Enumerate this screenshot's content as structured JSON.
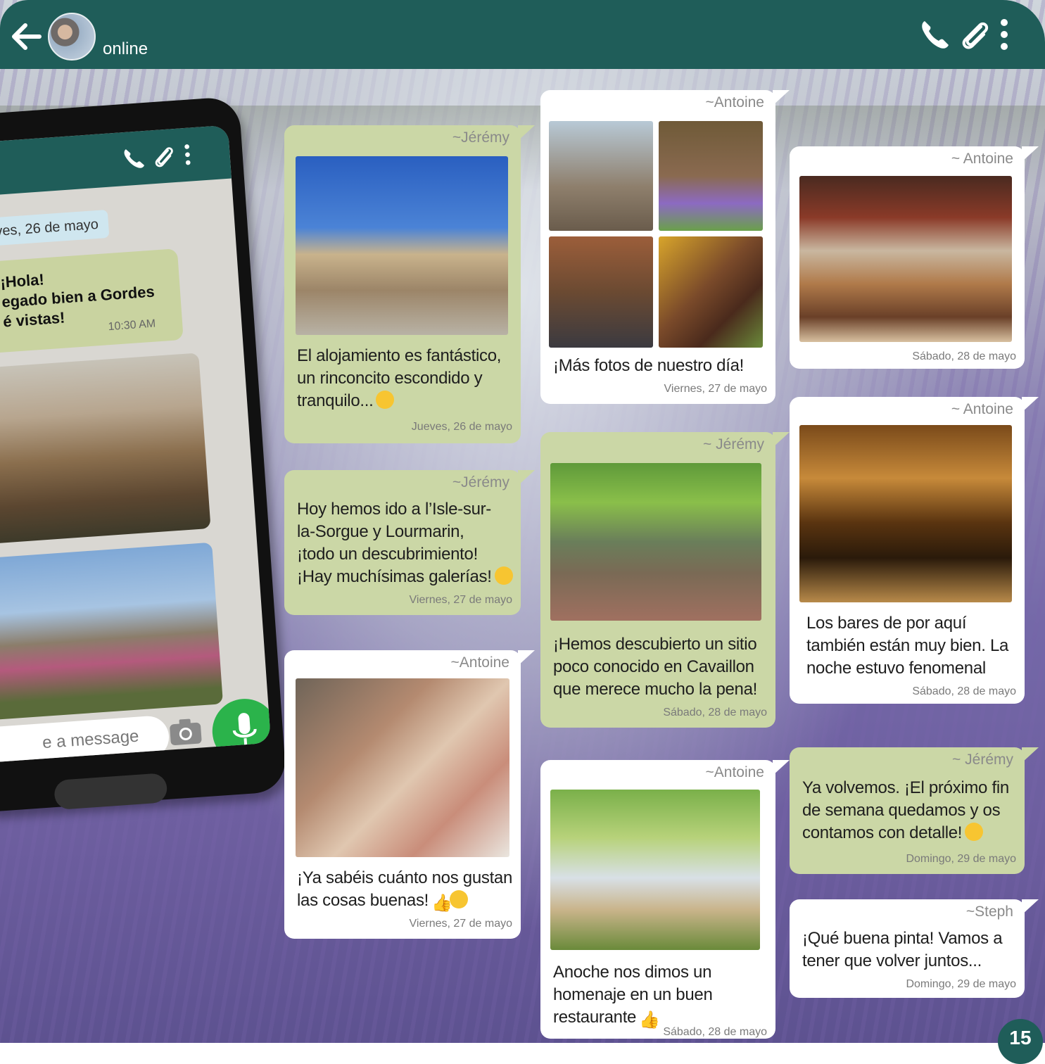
{
  "header": {
    "status": "online",
    "icons": [
      "back-arrow-icon",
      "avatar",
      "phone-icon",
      "paperclip-icon",
      "more-vertical-icon"
    ],
    "color": "#1f5d59"
  },
  "phone": {
    "date_chip": "ves, 26 de mayo",
    "message_lines": [
      "¡Hola!",
      "egado bien a Gordes",
      "é vistas!"
    ],
    "time": "10:30 AM",
    "input_placeholder": "e a message",
    "icons": [
      "phone-icon",
      "paperclip-icon",
      "more-vertical-icon",
      "camera-icon",
      "microphone-icon"
    ]
  },
  "messages": [
    {
      "sender": "~Jérémy",
      "text_lines": [
        "El alojamiento es fantástico,",
        "un rinconcito escondido y",
        "tranquilo..."
      ],
      "emoji": "sleeping-face",
      "date": "Jueves, 26 de mayo",
      "style": "green"
    },
    {
      "sender": "~Jérémy",
      "text_lines": [
        "Hoy hemos ido a l’Isle-sur-",
        "la-Sorgue y Lourmarin,",
        "¡todo un descubrimiento!",
        "¡Hay muchísimas galerías!"
      ],
      "emoji": "heart-eyes",
      "date": "Viernes, 27 de mayo",
      "style": "green"
    },
    {
      "sender": "~Antoine",
      "text_lines": [
        "¡Ya sabéis cuánto nos gustan",
        "las cosas buenas!"
      ],
      "emoji": "thumbs-up sunglasses",
      "date": "Viernes, 27 de mayo",
      "style": "white"
    },
    {
      "sender": "~Antoine",
      "text_lines": [
        "¡Más fotos de nuestro día!"
      ],
      "date": "Viernes, 27 de mayo",
      "style": "white"
    },
    {
      "sender": "~ Jérémy",
      "text_lines": [
        "¡Hemos descubierto un sitio",
        "poco conocido en Cavaillon",
        "que merece mucho la pena!"
      ],
      "date": "Sábado, 28 de mayo",
      "style": "green"
    },
    {
      "sender": "~Antoine",
      "text_lines": [
        "Anoche nos dimos un",
        "homenaje en un buen",
        "restaurante"
      ],
      "emoji": "thumbs-up",
      "date": "Sábado, 28 de mayo",
      "style": "white"
    },
    {
      "sender": "~ Antoine",
      "text_lines": [],
      "date": "Sábado, 28 de mayo",
      "style": "white"
    },
    {
      "sender": "~ Antoine",
      "text_lines": [
        "Los bares de por aquí",
        "también están muy bien. La",
        "noche estuvo fenomenal"
      ],
      "date": "Sábado, 28 de mayo",
      "style": "white"
    },
    {
      "sender": "~ Jérémy",
      "text_lines": [
        "Ya volvemos. ¡El próximo fin",
        "de semana quedamos y os",
        "contamos con detalle!"
      ],
      "emoji": "heart-eyes",
      "date": "Domingo, 29 de mayo",
      "style": "green"
    },
    {
      "sender": "~Steph",
      "text_lines": [
        "¡Qué buena pinta! Vamos a",
        "tener que volver juntos..."
      ],
      "date": "Domingo, 29 de mayo",
      "style": "white"
    }
  ],
  "page_number": "15"
}
